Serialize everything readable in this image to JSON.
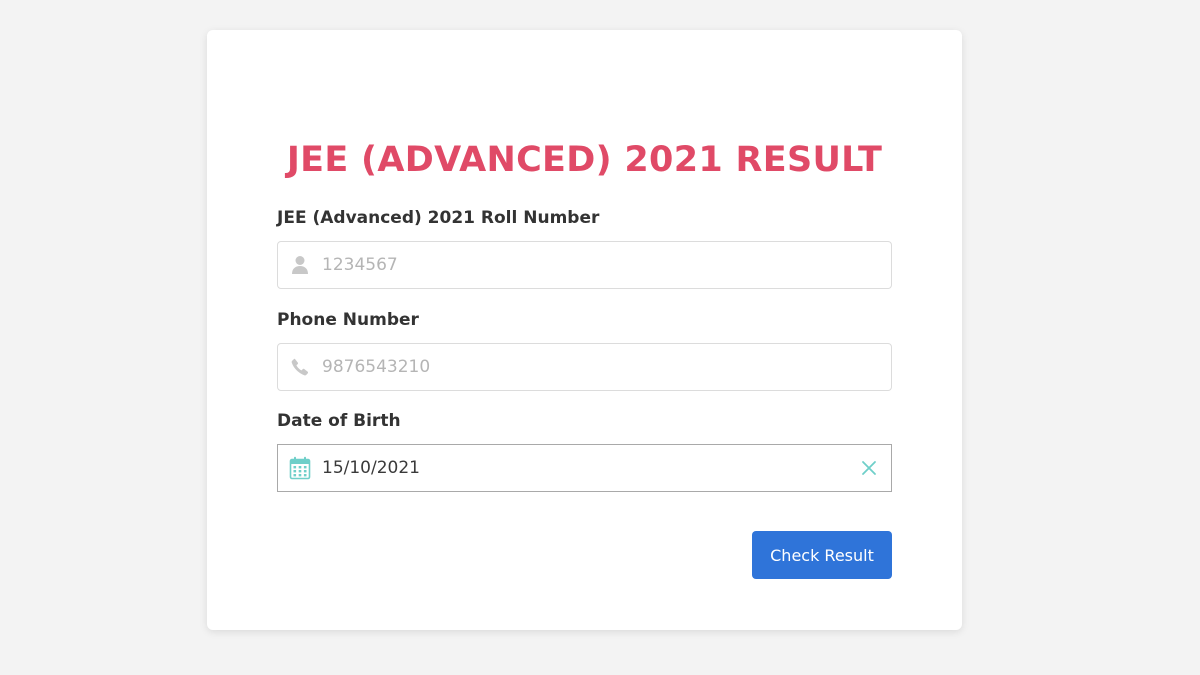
{
  "colors": {
    "title": "#e04a67",
    "button": "#2f74d9",
    "calendar_icon": "#6fcfc9",
    "clear_icon": "#6fcfc9",
    "muted_icon": "#c8c8c8"
  },
  "form": {
    "title": "JEE (ADVANCED) 2021 RESULT",
    "roll_number": {
      "label": "JEE (Advanced) 2021 Roll Number",
      "placeholder": "1234567",
      "icon": "user-icon"
    },
    "phone": {
      "label": "Phone Number",
      "placeholder": "9876543210",
      "icon": "phone-icon"
    },
    "dob": {
      "label": "Date of Birth",
      "value": "15/10/2021",
      "icon": "calendar-icon",
      "clear_icon": "close-icon"
    },
    "submit_label": "Check Result"
  }
}
